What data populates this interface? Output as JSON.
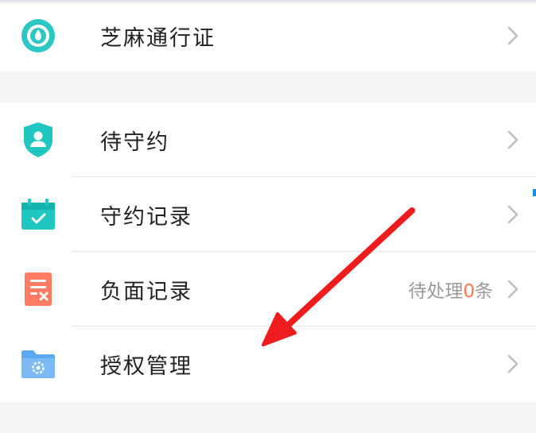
{
  "section1": {
    "items": [
      {
        "label": "芝麻通行证",
        "icon": "zhima-pass-icon",
        "color": "#2bc7c2"
      }
    ]
  },
  "section2": {
    "items": [
      {
        "label": "待守约",
        "icon": "shield-user-icon",
        "color": "#1fc7c0"
      },
      {
        "label": "守约记录",
        "icon": "calendar-check-icon",
        "color": "#1fc7c0"
      },
      {
        "label": "负面记录",
        "icon": "negative-record-icon",
        "color": "#ff7b63",
        "status_prefix": "待处理",
        "status_count": "0",
        "status_suffix": "条"
      },
      {
        "label": "授权管理",
        "icon": "folder-gear-icon",
        "color": "#5aa9f2"
      }
    ]
  },
  "colors": {
    "accent_teal": "#1fc7c0",
    "accent_orange": "#ff7a4a",
    "annotation_arrow": "#ee1c1c"
  }
}
